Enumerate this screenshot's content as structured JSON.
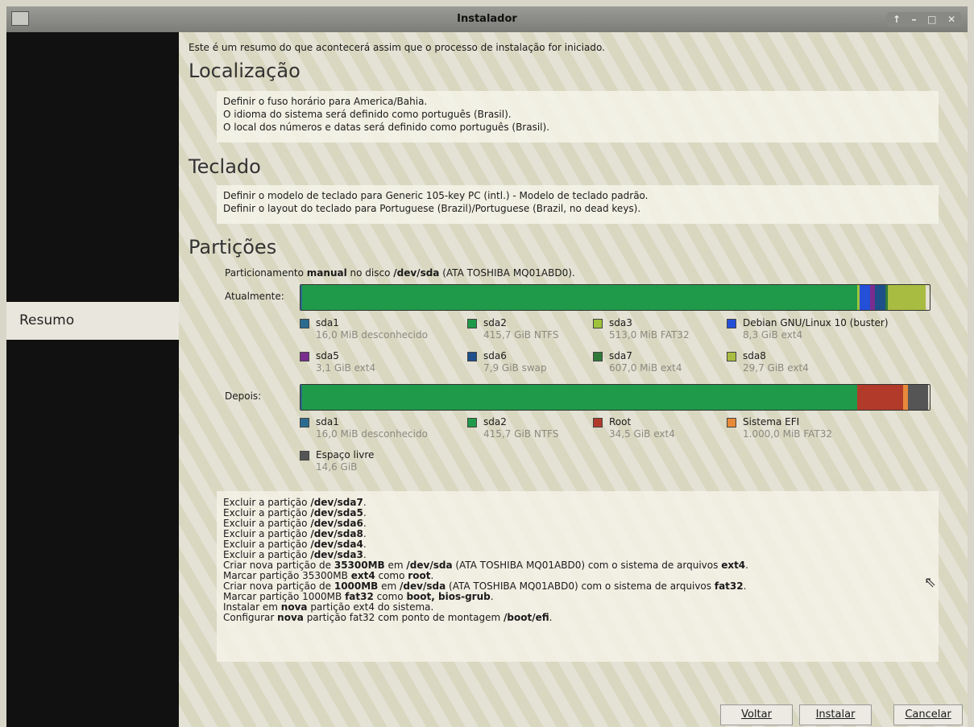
{
  "window": {
    "title": "Instalador",
    "controls": [
      "↑",
      "–",
      "□",
      "✕"
    ]
  },
  "sidebar": {
    "active_item": "Resumo"
  },
  "intro": "Este é um resumo do que acontecerá assim que o processo de instalação for iniciado.",
  "sections": {
    "localizacao": {
      "title": "Localização",
      "lines": [
        "Definir o fuso horário para America/Bahia.",
        "O idioma do sistema será definido como português (Brasil).",
        "O local dos números e datas será definido como português (Brasil)."
      ]
    },
    "teclado": {
      "title": "Teclado",
      "lines": [
        "Definir o modelo de teclado para Generic 105-key PC (intl.) - Modelo de teclado padrão.",
        "Definir o layout do teclado para Portuguese (Brazil)/Portuguese (Brazil, no dead keys)."
      ]
    },
    "particoes": {
      "title": "Partições",
      "summary_pre": "Particionamento ",
      "summary_b1": "manual",
      "summary_mid": " no disco ",
      "summary_b2": "/dev/sda",
      "summary_post": " (ATA TOSHIBA MQ01ABD0).",
      "current_label": "Atualmente:",
      "after_label": "Depois:"
    }
  },
  "partitions_current": [
    {
      "name": "sda1",
      "info": "16,0 MiB  desconhecido",
      "color": "#2b6b8f",
      "fraction": 0.0
    },
    {
      "name": "sda2",
      "info": "415,7 GiB  NTFS",
      "color": "#1f9a4a",
      "fraction": 0.882
    },
    {
      "name": "sda3",
      "info": "513,0 MiB  FAT32",
      "color": "#9fc23b",
      "fraction": 0.004
    },
    {
      "name": "Debian GNU/Linux 10 (buster)",
      "info": "8,3 GiB  ext4",
      "color": "#2450d8",
      "fraction": 0.016
    },
    {
      "name": "sda5",
      "info": "3,1 GiB  ext4",
      "color": "#7a2d8e",
      "fraction": 0.008
    },
    {
      "name": "sda6",
      "info": "7,9 GiB  swap",
      "color": "#1e4f8a",
      "fraction": 0.017
    },
    {
      "name": "sda7",
      "info": "607,0 MiB  ext4",
      "color": "#2f7a3a",
      "fraction": 0.004
    },
    {
      "name": "sda8",
      "info": "29,7 GiB  ext4",
      "color": "#a8bc42",
      "fraction": 0.06
    }
  ],
  "partitions_after": [
    {
      "name": "sda1",
      "info": "16,0 MiB  desconhecido",
      "color": "#2b6b8f",
      "fraction": 0.0
    },
    {
      "name": "sda2",
      "info": "415,7 GiB  NTFS",
      "color": "#1f9a4a",
      "fraction": 0.882
    },
    {
      "name": "Root",
      "info": "34,5 GiB  ext4",
      "color": "#b23a2a",
      "fraction": 0.073
    },
    {
      "name": "Sistema EFI",
      "info": "1.000,0 MiB  FAT32",
      "color": "#e8893a",
      "fraction": 0.008
    },
    {
      "name": "Espaço livre",
      "info": "14,6 GiB",
      "color": "#555555",
      "fraction": 0.031
    }
  ],
  "operations": [
    [
      "Excluir a partição ",
      {
        "b": "/dev/sda7"
      },
      "."
    ],
    [
      "Excluir a partição ",
      {
        "b": "/dev/sda5"
      },
      "."
    ],
    [
      "Excluir a partição ",
      {
        "b": "/dev/sda6"
      },
      "."
    ],
    [
      "Excluir a partição ",
      {
        "b": "/dev/sda8"
      },
      "."
    ],
    [
      "Excluir a partição ",
      {
        "b": "/dev/sda4"
      },
      "."
    ],
    [
      "Excluir a partição ",
      {
        "b": "/dev/sda3"
      },
      "."
    ],
    [
      "Criar nova partição de ",
      {
        "b": "35300MB"
      },
      " em ",
      {
        "b": "/dev/sda"
      },
      " (ATA TOSHIBA MQ01ABD0) com o sistema de arquivos ",
      {
        "b": "ext4"
      },
      "."
    ],
    [
      "Marcar partição 35300MB ",
      {
        "b": "ext4"
      },
      " como ",
      {
        "b": "root"
      },
      "."
    ],
    [
      "Criar nova partição de ",
      {
        "b": "1000MB"
      },
      " em ",
      {
        "b": "/dev/sda"
      },
      " (ATA TOSHIBA MQ01ABD0) com o sistema de arquivos ",
      {
        "b": "fat32"
      },
      "."
    ],
    [
      "Marcar partição 1000MB ",
      {
        "b": "fat32"
      },
      " como ",
      {
        "b": "boot, bios-grub"
      },
      "."
    ],
    [
      "Instalar em ",
      {
        "b": "nova"
      },
      " partição ext4 do sistema."
    ],
    [
      "Configurar ",
      {
        "b": "nova"
      },
      " partição fat32 com ponto de montagem ",
      {
        "b": "/boot/efi"
      },
      "."
    ]
  ],
  "buttons": {
    "back": "Voltar",
    "install": "Instalar",
    "cancel": "Cancelar"
  }
}
